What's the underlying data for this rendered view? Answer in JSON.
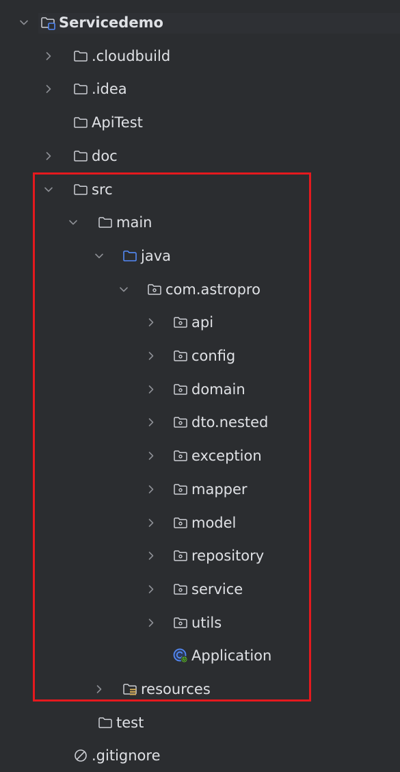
{
  "theme": {
    "background": "#2b2d30",
    "text": "#dfe1e5",
    "chevron": "#8c8f94",
    "folder_icon": "#ced0d6",
    "source_folder_icon": "#548af7",
    "class_icon": "#548af7",
    "highlight_border": "#e5191e"
  },
  "tree": [
    {
      "id": "servicedemo",
      "label": "Servicedemo",
      "depth": 0,
      "chevron": "down",
      "icon": "module-folder-icon",
      "bold": true
    },
    {
      "id": "cloudbuild",
      "label": ".cloudbuild",
      "depth": 1,
      "chevron": "right",
      "icon": "folder-icon"
    },
    {
      "id": "idea",
      "label": ".idea",
      "depth": 1,
      "chevron": "right",
      "icon": "folder-icon"
    },
    {
      "id": "apitest",
      "label": "ApiTest",
      "depth": 1,
      "chevron": "none",
      "icon": "folder-icon"
    },
    {
      "id": "doc",
      "label": "doc",
      "depth": 1,
      "chevron": "right",
      "icon": "folder-icon"
    },
    {
      "id": "src",
      "label": "src",
      "depth": 1,
      "chevron": "down",
      "icon": "folder-icon"
    },
    {
      "id": "main",
      "label": "main",
      "depth": 2,
      "chevron": "down",
      "icon": "folder-icon"
    },
    {
      "id": "java",
      "label": "java",
      "depth": 3,
      "chevron": "down",
      "icon": "source-folder-icon"
    },
    {
      "id": "com-astropro",
      "label": "com.astropro",
      "depth": 4,
      "chevron": "down",
      "icon": "package-icon"
    },
    {
      "id": "api",
      "label": "api",
      "depth": 5,
      "chevron": "right",
      "icon": "package-icon"
    },
    {
      "id": "config",
      "label": "config",
      "depth": 5,
      "chevron": "right",
      "icon": "package-icon"
    },
    {
      "id": "domain",
      "label": "domain",
      "depth": 5,
      "chevron": "right",
      "icon": "package-icon"
    },
    {
      "id": "dto-nested",
      "label": "dto.nested",
      "depth": 5,
      "chevron": "right",
      "icon": "package-icon"
    },
    {
      "id": "exception",
      "label": "exception",
      "depth": 5,
      "chevron": "right",
      "icon": "package-icon"
    },
    {
      "id": "mapper",
      "label": "mapper",
      "depth": 5,
      "chevron": "right",
      "icon": "package-icon"
    },
    {
      "id": "model",
      "label": "model",
      "depth": 5,
      "chevron": "right",
      "icon": "package-icon"
    },
    {
      "id": "repository",
      "label": "repository",
      "depth": 5,
      "chevron": "right",
      "icon": "package-icon"
    },
    {
      "id": "service",
      "label": "service",
      "depth": 5,
      "chevron": "right",
      "icon": "package-icon"
    },
    {
      "id": "utils",
      "label": "utils",
      "depth": 5,
      "chevron": "right",
      "icon": "package-icon"
    },
    {
      "id": "application",
      "label": "Application",
      "depth": 5,
      "chevron": "none",
      "icon": "spring-boot-class-icon"
    },
    {
      "id": "resources",
      "label": "resources",
      "depth": 3,
      "chevron": "right",
      "icon": "resources-folder-icon"
    },
    {
      "id": "test",
      "label": "test",
      "depth": 2,
      "chevron": "none",
      "icon": "folder-icon"
    },
    {
      "id": "gitignore",
      "label": ".gitignore",
      "depth": 1,
      "chevron": "none",
      "icon": "ignored-file-icon"
    }
  ]
}
